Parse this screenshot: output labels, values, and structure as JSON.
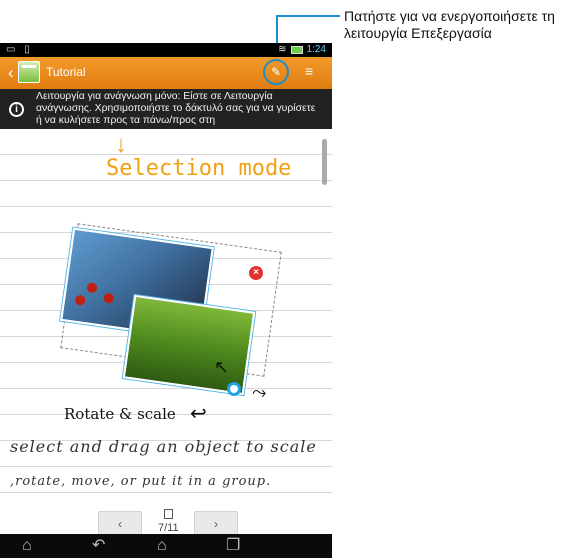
{
  "callout": {
    "text": "Πατήστε για να ενεργοποιήσετε τη λειτουργία Επεξεργασία"
  },
  "statusbar": {
    "time": "1:24"
  },
  "actionbar": {
    "title": "Tutorial"
  },
  "info": {
    "text": "Λειτουργία για ανάγνωση μόνο: Είστε σε Λειτουργία ανάγνωσης. Χρησιμοποιήστε το δάκτυλό σας για να γυρίσετε ή να κυλήσετε προς τα πάνω/προς στη"
  },
  "note": {
    "selection_mode": "Selection mode",
    "rotate_scale": "Rotate & scale",
    "line1": "select and drag an object to scale",
    "line2": ",rotate, move, or put it in a group."
  },
  "pager": {
    "prev": "‹",
    "next": "›",
    "page": "7/11"
  },
  "colors": {
    "actionbar": "#e88a1c",
    "accent": "#1a8fd0",
    "handwriting_orange": "#f0a014"
  },
  "icons": [
    "back-chevron-icon",
    "app-icon",
    "edit-mode-icon",
    "menu-icon",
    "info-icon",
    "close-icon",
    "rotate-handle-icon",
    "page-icon",
    "nav-home-up-icon",
    "nav-back-icon",
    "nav-home-icon",
    "nav-recent-icon"
  ]
}
